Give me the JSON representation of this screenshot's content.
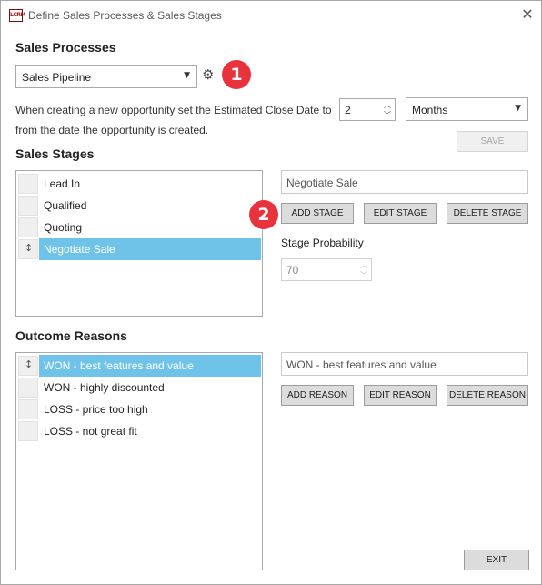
{
  "window": {
    "title": "Define Sales Processes & Sales Stages",
    "icon_text": "LCRM"
  },
  "sales_processes": {
    "heading": "Sales Processes",
    "selected": "Sales Pipeline",
    "badge": "1"
  },
  "close_date": {
    "line1": "When creating a new opportunity set the Estimated Close Date to",
    "line2": "from the date the opportunity is created.",
    "amount": "2",
    "unit": "Months",
    "save_label": "SAVE"
  },
  "sales_stages": {
    "heading": "Sales Stages",
    "items": [
      {
        "label": "Lead In"
      },
      {
        "label": "Qualified"
      },
      {
        "label": "Quoting"
      },
      {
        "label": "Negotiate Sale"
      }
    ],
    "selected_index": 3,
    "stage_name": "Negotiate Sale",
    "badge": "2",
    "add_label": "ADD STAGE",
    "edit_label": "EDIT STAGE",
    "delete_label": "DELETE STAGE",
    "probability_label": "Stage Probability",
    "probability_value": "70"
  },
  "outcome_reasons": {
    "heading": "Outcome Reasons",
    "items": [
      {
        "label": "WON - best features and value"
      },
      {
        "label": "WON - highly discounted"
      },
      {
        "label": "LOSS - price too high"
      },
      {
        "label": "LOSS - not great fit"
      }
    ],
    "selected_index": 0,
    "reason_name": "WON - best features and value",
    "add_label": "ADD REASON",
    "edit_label": "EDIT REASON",
    "delete_label": "DELETE REASON"
  },
  "footer": {
    "exit_label": "EXIT"
  },
  "colors": {
    "selection": "#6fc2e8",
    "badge": "#e8323c"
  }
}
